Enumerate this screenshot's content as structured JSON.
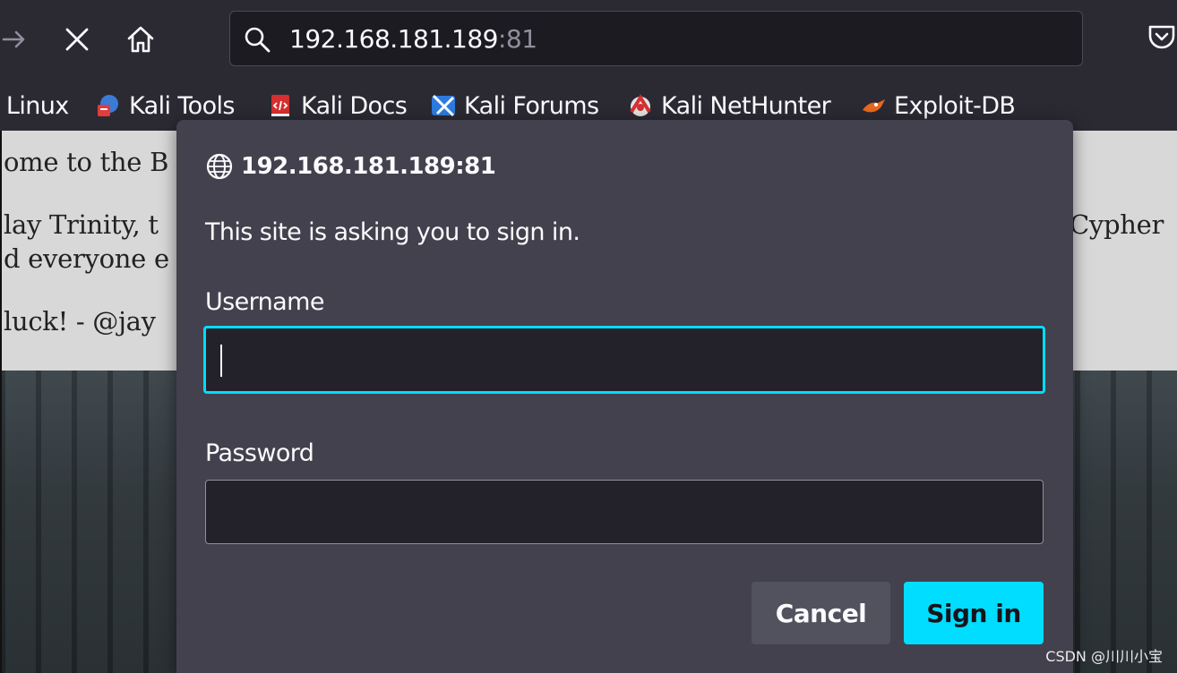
{
  "navbar": {
    "url_host": "192.168.181.189",
    "url_port": ":81",
    "icons": [
      "forward-icon",
      "stop-icon",
      "home-icon",
      "search-icon",
      "pocket-icon"
    ]
  },
  "bookmarks": [
    {
      "label": "i Linux",
      "icon": "kali-icon"
    },
    {
      "label": "Kali Tools",
      "icon": "kali-tools-icon"
    },
    {
      "label": "Kali Docs",
      "icon": "kali-docs-icon"
    },
    {
      "label": "Kali Forums",
      "icon": "kali-forums-icon"
    },
    {
      "label": "Kali NetHunter",
      "icon": "kali-nethunter-icon"
    },
    {
      "label": "Exploit-DB",
      "icon": "exploit-db-icon"
    }
  ],
  "page": {
    "line1_left": "ome to the B",
    "line2_left": "lay Trinity, t",
    "line2_right": "Cypher",
    "line3_left": "d everyone e",
    "line4_left": "luck! - @jay"
  },
  "dialog": {
    "origin": "192.168.181.189:81",
    "message": "This site is asking you to sign in.",
    "username_label": "Username",
    "username_value": "",
    "password_label": "Password",
    "password_value": "",
    "cancel_label": "Cancel",
    "signin_label": "Sign in"
  },
  "colors": {
    "accent": "#00ddff",
    "dialog_bg": "#42414d",
    "chrome_bg": "#2b2a33"
  },
  "watermark": "CSDN @川川小宝"
}
